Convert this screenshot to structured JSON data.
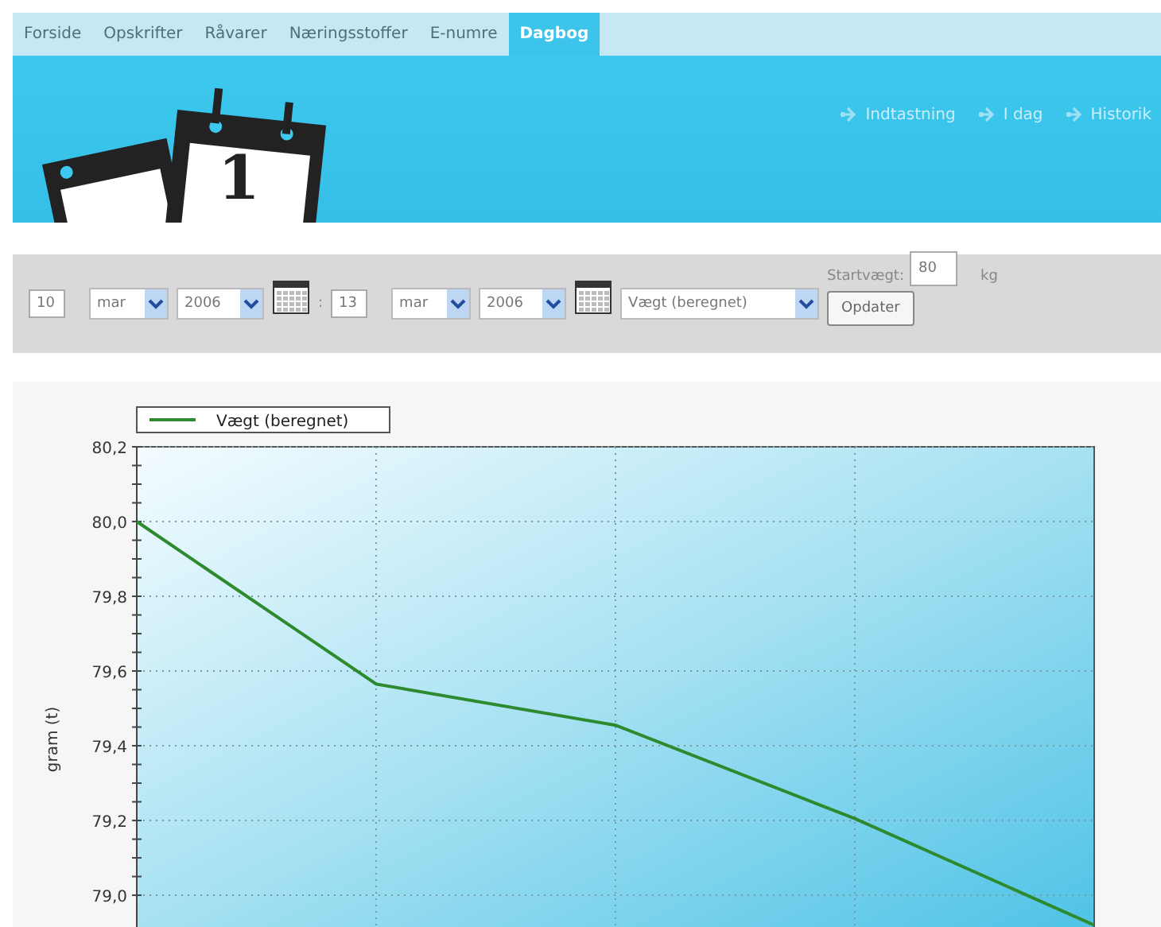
{
  "nav": {
    "tabs": [
      {
        "label": "Forside",
        "selected": false
      },
      {
        "label": "Opskrifter",
        "selected": false
      },
      {
        "label": "Råvarer",
        "selected": false
      },
      {
        "label": "Næringsstoffer",
        "selected": false
      },
      {
        "label": "E-numre",
        "selected": false
      },
      {
        "label": "Dagbog",
        "selected": true
      }
    ]
  },
  "header": {
    "logo_digit": "1",
    "links": [
      "Indtastning",
      "I dag",
      "Historik"
    ]
  },
  "filter": {
    "from": {
      "day": "10",
      "month": "mar",
      "year": "2006"
    },
    "separator": ":",
    "to": {
      "day": "13",
      "month": "mar",
      "year": "2006"
    },
    "measure": "Vægt (beregnet)",
    "start_label": "Startvægt:",
    "start_value": "80",
    "unit": "kg",
    "button": "Opdater"
  },
  "chart": {
    "chart_data": {
      "type": "line",
      "grid": true,
      "ylabel": "gram (t)",
      "categories": [
        null,
        null,
        null,
        null,
        null
      ],
      "ylim": [
        78.915,
        80.2
      ],
      "yticks": [
        {
          "value": 79.0,
          "label": "79,0"
        },
        {
          "value": 79.2,
          "label": "79,2"
        },
        {
          "value": 79.4,
          "label": "79,4"
        },
        {
          "value": 79.6,
          "label": "79,6"
        },
        {
          "value": 79.8,
          "label": "79,8"
        },
        {
          "value": 80.0,
          "label": "80,0"
        },
        {
          "value": 80.2,
          "label": "80,2"
        }
      ],
      "series": [
        {
          "name": "Vægt (beregnet)",
          "color": "#2e8a2e",
          "values": [
            80.0,
            79.565,
            79.455,
            79.205,
            78.92
          ]
        }
      ]
    }
  }
}
